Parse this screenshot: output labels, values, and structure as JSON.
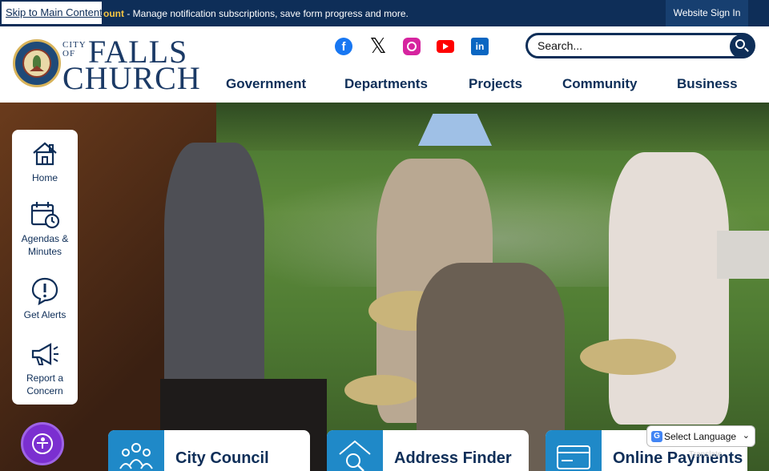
{
  "topbar": {
    "skip_link": "Skip to Main Content",
    "message_highlight": "ount",
    "message_text": " - Manage notification subscriptions, save form progress and more.",
    "signin": "Website Sign In"
  },
  "brand": {
    "seal_alt": "City of Falls Church Virginia seal",
    "city_of_line1": "CITY",
    "city_of_line2": "OF",
    "falls": "FALLS",
    "church": "CHURCH"
  },
  "social": [
    {
      "name": "facebook-icon",
      "glyph": "f"
    },
    {
      "name": "x-icon",
      "glyph": "𝕏"
    },
    {
      "name": "instagram-icon"
    },
    {
      "name": "youtube-icon"
    },
    {
      "name": "linkedin-icon",
      "glyph": "in"
    }
  ],
  "search": {
    "placeholder": "Search..."
  },
  "nav": {
    "government": "Government",
    "departments": "Departments",
    "projects": "Projects",
    "community": "Community",
    "business": "Business"
  },
  "quick_links": {
    "home": "Home",
    "agendas": "Agendas & Minutes",
    "alerts": "Get Alerts",
    "concern": "Report a Concern"
  },
  "features": {
    "council": "City Council",
    "address": "Address Finder",
    "payments": "Online Payments"
  },
  "translate": {
    "label": "Select Language",
    "powered": "Translate"
  },
  "colors": {
    "navy": "#0e2e58",
    "accent_blue": "#1f89c8",
    "a11y_purple": "#7b2fd0"
  }
}
